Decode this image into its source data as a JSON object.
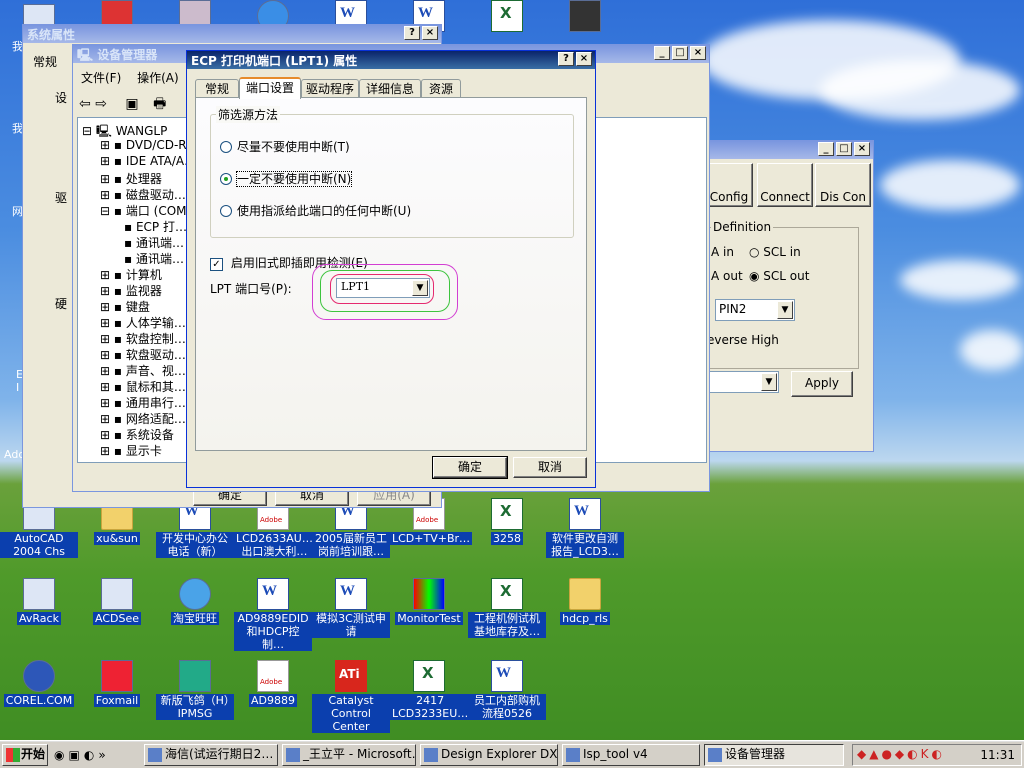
{
  "desktop": {
    "icons": [
      {
        "label": "AutoCAD 2004 Chs",
        "type": "generic"
      },
      {
        "label": "xu&sun",
        "type": "folder"
      },
      {
        "label": "开发中心办公电话（新）",
        "type": "word"
      },
      {
        "label": "LCD2633AU…出口澳大利…",
        "type": "pdf"
      },
      {
        "label": "2005届新员工岗前培训跟…",
        "type": "word"
      },
      {
        "label": "LCD+TV+Br…",
        "type": "pdf"
      },
      {
        "label": "3258",
        "type": "excel"
      },
      {
        "label": "软件更改自测报告_LCD3…",
        "type": "word"
      },
      {
        "label": "AvRack",
        "type": "generic"
      },
      {
        "label": "ACDSee",
        "type": "generic"
      },
      {
        "label": "淘宝旺旺",
        "type": "generic"
      },
      {
        "label": "AD9889EDID和HDCP控制…",
        "type": "word"
      },
      {
        "label": "模拟3C测试申请",
        "type": "word"
      },
      {
        "label": "MonitorTest",
        "type": "generic"
      },
      {
        "label": "工程机例试机基地库存及…",
        "type": "excel"
      },
      {
        "label": "hdcp_rls",
        "type": "folder"
      },
      {
        "label": "COREL.COM",
        "type": "generic"
      },
      {
        "label": "Foxmail",
        "type": "generic"
      },
      {
        "label": "新版飞鸽（H）IPMSG",
        "type": "generic"
      },
      {
        "label": "AD9889",
        "type": "pdf"
      },
      {
        "label": "Catalyst Control Center",
        "type": "ati"
      },
      {
        "label": "2417 LCD3233EU…",
        "type": "excel"
      },
      {
        "label": "员工内部购机流程0526",
        "type": "word"
      }
    ],
    "partial_labels": {
      "left1": "我",
      "left2": "我",
      "left3": "网",
      "left4": "E I",
      "left5": "Add"
    }
  },
  "system_props": {
    "title": "系统属性",
    "tab": "常规",
    "group1": "设",
    "group2": "驱",
    "group3": "硬",
    "ok": "确定",
    "cancel": "取消",
    "apply": "应用(A)"
  },
  "device_manager": {
    "title": "设备管理器",
    "menu": [
      "文件(F)",
      "操作(A)"
    ],
    "tree": {
      "root": "WANGLP",
      "items": [
        {
          "label": "DVD/CD-R…",
          "expand": "+",
          "indent": 1
        },
        {
          "label": "IDE ATA/A…",
          "expand": "+",
          "indent": 1
        },
        {
          "label": "处理器",
          "expand": "+",
          "indent": 1
        },
        {
          "label": "磁盘驱动…",
          "expand": "+",
          "indent": 1
        },
        {
          "label": "端口 (COM…",
          "expand": "-",
          "indent": 1
        },
        {
          "label": "ECP 打…",
          "expand": "",
          "indent": 2
        },
        {
          "label": "通讯端…",
          "expand": "",
          "indent": 2
        },
        {
          "label": "通讯端…",
          "expand": "",
          "indent": 2
        },
        {
          "label": "计算机",
          "expand": "+",
          "indent": 1
        },
        {
          "label": "监视器",
          "expand": "+",
          "indent": 1
        },
        {
          "label": "键盘",
          "expand": "+",
          "indent": 1
        },
        {
          "label": "人体学输…",
          "expand": "+",
          "indent": 1
        },
        {
          "label": "软盘控制…",
          "expand": "+",
          "indent": 1
        },
        {
          "label": "软盘驱动…",
          "expand": "+",
          "indent": 1
        },
        {
          "label": "声音、视…",
          "expand": "+",
          "indent": 1
        },
        {
          "label": "鼠标和其…",
          "expand": "+",
          "indent": 1
        },
        {
          "label": "通用串行…",
          "expand": "+",
          "indent": 1
        },
        {
          "label": "网络适配…",
          "expand": "+",
          "indent": 1
        },
        {
          "label": "系统设备",
          "expand": "+",
          "indent": 1
        },
        {
          "label": "显示卡",
          "expand": "+",
          "indent": 1
        }
      ]
    }
  },
  "isp_tool": {
    "toolbar": [
      "Config",
      "Connect",
      "Dis Con"
    ],
    "group_label": "Definition",
    "radio_rows": [
      {
        "left": "A in",
        "right": "SCL in"
      },
      {
        "left": "A out",
        "right": "SCL out"
      }
    ],
    "pin_select": "PIN2",
    "reverse": "everse High",
    "apply": "Apply"
  },
  "ecp_dialog": {
    "title": "ECP 打印机端口 (LPT1) 属性",
    "tabs": [
      "常规",
      "端口设置",
      "驱动程序",
      "详细信息",
      "资源"
    ],
    "active_tab": 1,
    "group_title": "筛选源方法",
    "radios": [
      {
        "label": "尽量不要使用中断(T)",
        "checked": false
      },
      {
        "label": "一定不要使用中断(N)",
        "checked": true
      },
      {
        "label": "使用指派给此端口的任何中断(U)",
        "checked": false
      }
    ],
    "legacy_checkbox": {
      "label": "启用旧式即插即用检测(E)",
      "checked": true
    },
    "lpt_label": "LPT 端口号(P):",
    "lpt_value": "LPT1",
    "ok": "确定",
    "cancel": "取消"
  },
  "taskbar": {
    "start": "开始",
    "items": [
      {
        "label": "海信(试运行期日2…",
        "active": false
      },
      {
        "label": "_王立平 - Microsoft…",
        "active": false
      },
      {
        "label": "Design Explorer DXP",
        "active": false
      },
      {
        "label": "Isp_tool v4",
        "active": false
      },
      {
        "label": "设备管理器",
        "active": true
      }
    ],
    "clock": "11:31"
  }
}
